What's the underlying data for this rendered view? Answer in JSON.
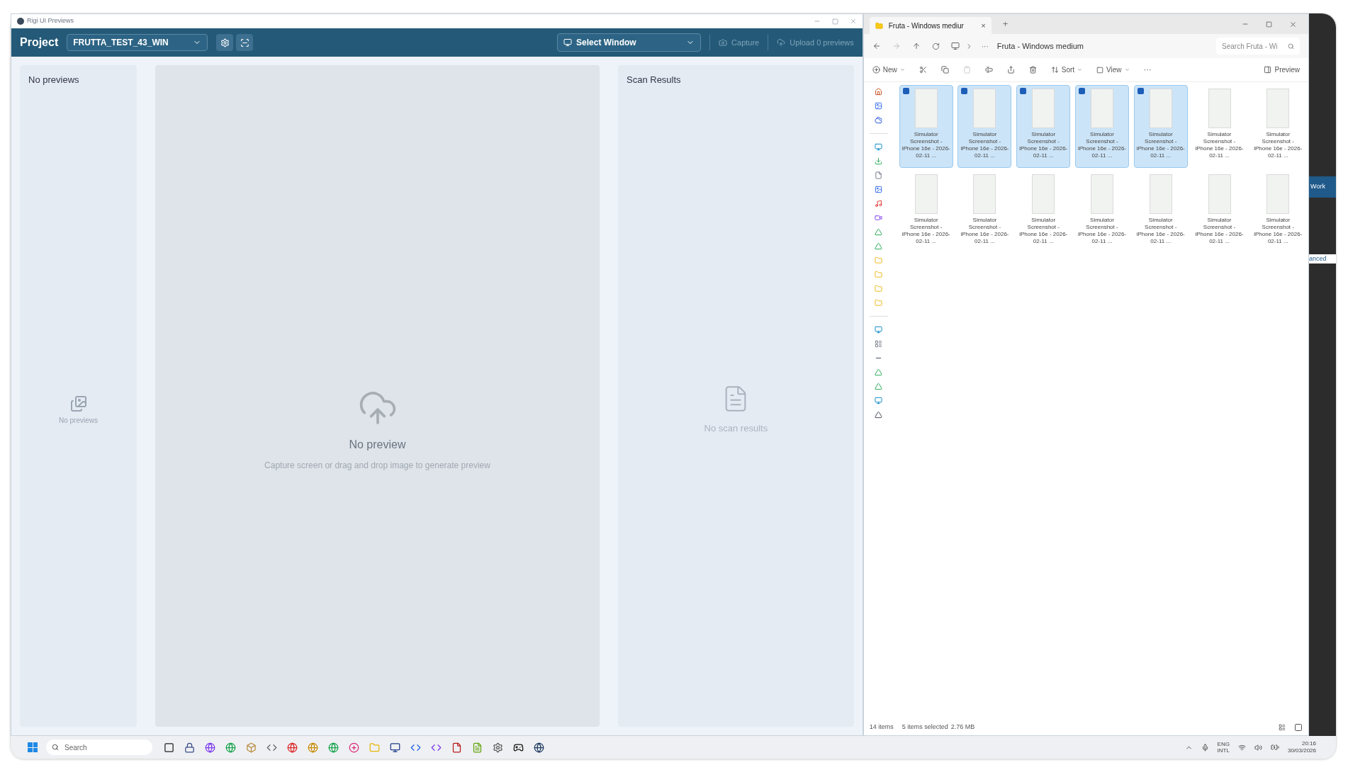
{
  "app_window": {
    "title": "Rigi UI Previews",
    "header": {
      "project_label": "Project",
      "project_select": "FRUTTA_TEST_43_WIN",
      "window_select": "Select Window",
      "capture": {
        "label": "Capture",
        "disabled": true
      },
      "upload": {
        "label": "Upload 0 previews",
        "disabled": true
      }
    },
    "previews_panel": {
      "title": "No previews",
      "empty_text": "No previews"
    },
    "preview_area": {
      "title": "No preview",
      "hint": "Capture screen or drag and drop image to generate preview"
    },
    "scan_panel": {
      "title": "Scan Results",
      "empty_text": "No scan results"
    }
  },
  "explorer": {
    "tab": "Fruta - Windows mediur",
    "tab_close": "×",
    "new_tab": "+",
    "more_path": "···",
    "breadcrumb": "Fruta - Windows medium",
    "search": {
      "placeholder": "Search Fruta - Wi"
    },
    "toolbar": {
      "new": "New",
      "sort": "Sort",
      "view": "View",
      "more": "···",
      "preview": "Preview"
    },
    "files": [
      {
        "name": "Simulator Screenshot - iPhone 16e - 2026-02-11 ...",
        "selected": true
      },
      {
        "name": "Simulator Screenshot - iPhone 16e - 2026-02-11 ...",
        "selected": true
      },
      {
        "name": "Simulator Screenshot - iPhone 16e - 2026-02-11 ...",
        "selected": true
      },
      {
        "name": "Simulator Screenshot - iPhone 16e - 2026-02-11 ...",
        "selected": true
      },
      {
        "name": "Simulator Screenshot - iPhone 16e - 2026-02-11 ...",
        "selected": true
      },
      {
        "name": "Simulator Screenshot - iPhone 16e - 2026-02-11 ...",
        "selected": false
      },
      {
        "name": "Simulator Screenshot - iPhone 16e - 2026-02-11 ...",
        "selected": false
      },
      {
        "name": "Simulator Screenshot - iPhone 16e - 2026-02-11 ...",
        "selected": false
      },
      {
        "name": "Simulator Screenshot - iPhone 16e - 2026-02-11 ...",
        "selected": false
      },
      {
        "name": "Simulator Screenshot - iPhone 16e - 2026-02-11 ...",
        "selected": false
      },
      {
        "name": "Simulator Screenshot - iPhone 16e - 2026-02-11 ...",
        "selected": false
      },
      {
        "name": "Simulator Screenshot - iPhone 16e - 2026-02-11 ...",
        "selected": false
      },
      {
        "name": "Simulator Screenshot - iPhone 16e - 2026-02-11 ...",
        "selected": false
      },
      {
        "name": "Simulator Screenshot - iPhone 16e - 2026-02-11 ...",
        "selected": false
      }
    ],
    "status": {
      "count": "14 items",
      "selection": "5 items selected",
      "size": "2.76 MB"
    }
  },
  "background_window": {
    "texts": [
      "Work",
      "anced"
    ]
  },
  "taskbar": {
    "search_placeholder": "Search",
    "language": "ENG",
    "layout": "INTL",
    "time": "20:16",
    "date": "30/03/2026"
  }
}
